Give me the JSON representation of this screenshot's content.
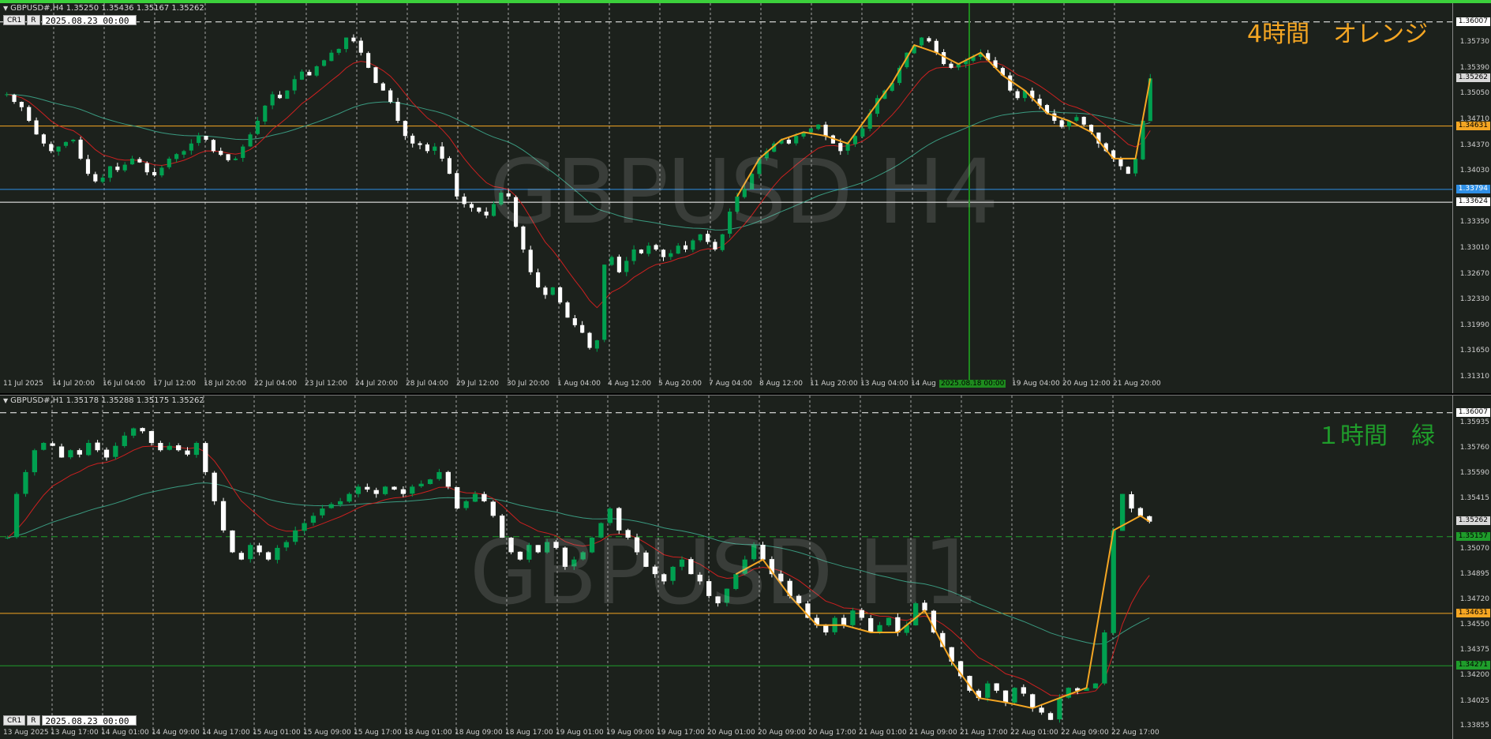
{
  "chart_data": [
    {
      "type": "candlestick",
      "symbol_header": "GBPUSD#,H4  1.35250 1.35436 1.35167 1.35262",
      "watermark": "GBPUSD H4",
      "annotation": "4時間　オレンジ",
      "annotation_color": "#f5a623",
      "datetime_box": "2025.08.23 00:00",
      "ylim": [
        1.3131,
        1.3615
      ],
      "price_ticks": [
        "1.35730",
        "1.35390",
        "1.35050",
        "1.34710",
        "1.34370",
        "1.34030",
        "1.33350",
        "1.33010",
        "1.32670",
        "1.32330",
        "1.31990",
        "1.31650",
        "1.31310"
      ],
      "price_badges": [
        {
          "text": "1.36007",
          "value": 1.36007,
          "bg": "#ffffff",
          "fg": "#000000"
        },
        {
          "text": "1.35262",
          "value": 1.35262,
          "bg": "#d8d8d8",
          "fg": "#000000"
        },
        {
          "text": "1.34631",
          "value": 1.34631,
          "bg": "#f5a623",
          "fg": "#000000"
        },
        {
          "text": "1.33794",
          "value": 1.33794,
          "bg": "#2e8fe6",
          "fg": "#ffffff"
        },
        {
          "text": "1.33624",
          "value": 1.33624,
          "bg": "#ffffff",
          "fg": "#000000"
        }
      ],
      "time_ticks": [
        "11 Jul 2025",
        "14 Jul 20:00",
        "16 Jul 04:00",
        "17 Jul 12:00",
        "18 Jul 20:00",
        "22 Jul 04:00",
        "23 Jul 12:00",
        "24 Jul 20:00",
        "28 Jul 04:00",
        "29 Jul 12:00",
        "30 Jul 20:00",
        "1 Aug 04:00",
        "4 Aug 12:00",
        "5 Aug 20:00",
        "7 Aug 04:00",
        "8 Aug 12:00",
        "11 Aug 20:00",
        "13 Aug 04:00",
        "14 Aug",
        "19 Aug 04:00",
        "20 Aug 12:00",
        "21 Aug 20:00"
      ],
      "cursor_time_label": "2025.08.18 00:00",
      "hlines": [
        {
          "value": 1.36007,
          "color": "#ffffff",
          "style": "dashed"
        },
        {
          "value": 1.34631,
          "color": "#f5a623",
          "style": "solid"
        },
        {
          "value": 1.33794,
          "color": "#2e8fe6",
          "style": "solid"
        },
        {
          "value": 1.33624,
          "color": "#ffffff",
          "style": "solid"
        }
      ],
      "colors": {
        "bull": "#00a050",
        "bear": "#ffffff",
        "ma_fast": "#cc2020",
        "ma_slow": "#3a9a80",
        "zigzag": "#f5a623",
        "cursor": "#1e8a1e"
      },
      "closes": [
        1.3505,
        1.3495,
        1.3488,
        1.347,
        1.3452,
        1.344,
        1.343,
        1.3436,
        1.3442,
        1.3445,
        1.342,
        1.34,
        1.339,
        1.3395,
        1.341,
        1.3405,
        1.3412,
        1.342,
        1.3415,
        1.3402,
        1.3398,
        1.3408,
        1.342,
        1.3426,
        1.343,
        1.344,
        1.345,
        1.3445,
        1.343,
        1.3425,
        1.3418,
        1.342,
        1.3436,
        1.3452,
        1.347,
        1.349,
        1.3505,
        1.35,
        1.351,
        1.3525,
        1.3535,
        1.353,
        1.3542,
        1.355,
        1.356,
        1.3565,
        1.358,
        1.3575,
        1.356,
        1.354,
        1.352,
        1.351,
        1.3495,
        1.347,
        1.345,
        1.344,
        1.3438,
        1.343,
        1.3436,
        1.342,
        1.34,
        1.337,
        1.336,
        1.3355,
        1.335,
        1.3345,
        1.336,
        1.3375,
        1.337,
        1.333,
        1.33,
        1.327,
        1.325,
        1.324,
        1.325,
        1.323,
        1.321,
        1.32,
        1.319,
        1.317,
        1.318,
        1.328,
        1.329,
        1.327,
        1.3285,
        1.33,
        1.3295,
        1.3305,
        1.33,
        1.329,
        1.3295,
        1.3305,
        1.33,
        1.3312,
        1.332,
        1.331,
        1.33,
        1.332,
        1.335,
        1.337,
        1.338,
        1.34,
        1.342,
        1.343,
        1.344,
        1.3445,
        1.344,
        1.345,
        1.3455,
        1.346,
        1.3465,
        1.345,
        1.344,
        1.343,
        1.344,
        1.345,
        1.346,
        1.348,
        1.35,
        1.351,
        1.352,
        1.354,
        1.356,
        1.357,
        1.358,
        1.3575,
        1.356,
        1.3545,
        1.354,
        1.3545,
        1.355,
        1.3555,
        1.356,
        1.355,
        1.354,
        1.353,
        1.351,
        1.35,
        1.351,
        1.35,
        1.349,
        1.348,
        1.347,
        1.3462,
        1.347,
        1.3475,
        1.3465,
        1.3455,
        1.344,
        1.343,
        1.342,
        1.341,
        1.34,
        1.342,
        1.347,
        1.3526
      ]
    },
    {
      "type": "candlestick",
      "symbol_header": "GBPUSD#,H1  1.35178 1.35288 1.35175 1.35262",
      "watermark": "GBPUSD H1",
      "annotation": "１時間　緑",
      "annotation_color": "#1f9d2b",
      "datetime_box": "2025.08.23 00:00",
      "ylim": [
        1.3385,
        1.3606
      ],
      "price_ticks": [
        "1.35935",
        "1.35760",
        "1.35590",
        "1.35415",
        "1.35070",
        "1.34895",
        "1.34720",
        "1.34550",
        "1.34375",
        "1.34200",
        "1.34025",
        "1.33855"
      ],
      "price_badges": [
        {
          "text": "1.36007",
          "value": 1.36007,
          "bg": "#ffffff",
          "fg": "#000000"
        },
        {
          "text": "1.35262",
          "value": 1.35262,
          "bg": "#d8d8d8",
          "fg": "#000000"
        },
        {
          "text": "1.35157",
          "value": 1.35157,
          "bg": "#1f9d2b",
          "fg": "#000000"
        },
        {
          "text": "1.34631",
          "value": 1.34631,
          "bg": "#f5a623",
          "fg": "#000000"
        },
        {
          "text": "1.34271",
          "value": 1.34271,
          "bg": "#1f9d2b",
          "fg": "#000000"
        }
      ],
      "time_ticks": [
        "13 Aug 2025",
        "13 Aug 17:00",
        "14 Aug 01:00",
        "14 Aug 09:00",
        "14 Aug 17:00",
        "15 Aug 01:00",
        "15 Aug 09:00",
        "15 Aug 17:00",
        "18 Aug 01:00",
        "18 Aug 09:00",
        "18 Aug 17:00",
        "19 Aug 01:00",
        "19 Aug 09:00",
        "19 Aug 17:00",
        "20 Aug 01:00",
        "20 Aug 09:00",
        "20 Aug 17:00",
        "21 Aug 01:00",
        "21 Aug 09:00",
        "21 Aug 17:00",
        "22 Aug 01:00",
        "22 Aug 09:00",
        "22 Aug 17:00"
      ],
      "hlines": [
        {
          "value": 1.36007,
          "color": "#ffffff",
          "style": "dashed"
        },
        {
          "value": 1.35157,
          "color": "#1f9d2b",
          "style": "dashed"
        },
        {
          "value": 1.34631,
          "color": "#f5a623",
          "style": "solid"
        },
        {
          "value": 1.34271,
          "color": "#1f9d2b",
          "style": "solid"
        }
      ],
      "colors": {
        "bull": "#00a050",
        "bear": "#ffffff",
        "ma_fast": "#cc2020",
        "ma_slow": "#3a9a80",
        "zigzag": "#f5a623"
      },
      "closes": [
        1.3515,
        1.3545,
        1.356,
        1.3575,
        1.358,
        1.3578,
        1.357,
        1.3575,
        1.3572,
        1.358,
        1.3575,
        1.357,
        1.3578,
        1.3585,
        1.359,
        1.3588,
        1.358,
        1.3575,
        1.3578,
        1.3575,
        1.3572,
        1.358,
        1.356,
        1.354,
        1.352,
        1.3505,
        1.35,
        1.351,
        1.3505,
        1.35,
        1.3508,
        1.3512,
        1.352,
        1.3525,
        1.353,
        1.3535,
        1.3538,
        1.354,
        1.3545,
        1.355,
        1.3548,
        1.3545,
        1.355,
        1.3548,
        1.3545,
        1.355,
        1.3552,
        1.3555,
        1.356,
        1.355,
        1.3535,
        1.354,
        1.3545,
        1.354,
        1.353,
        1.3515,
        1.3505,
        1.35,
        1.351,
        1.3505,
        1.3512,
        1.3508,
        1.3495,
        1.35,
        1.3505,
        1.3515,
        1.3525,
        1.3535,
        1.352,
        1.3515,
        1.3505,
        1.3495,
        1.349,
        1.3485,
        1.3495,
        1.35,
        1.349,
        1.3485,
        1.3475,
        1.347,
        1.348,
        1.349,
        1.35,
        1.351,
        1.35,
        1.349,
        1.3485,
        1.3475,
        1.347,
        1.346,
        1.3455,
        1.345,
        1.346,
        1.3455,
        1.3465,
        1.346,
        1.345,
        1.3455,
        1.346,
        1.345,
        1.3455,
        1.347,
        1.3465,
        1.345,
        1.344,
        1.343,
        1.342,
        1.341,
        1.3405,
        1.3415,
        1.341,
        1.3402,
        1.3412,
        1.3408,
        1.3398,
        1.3395,
        1.339,
        1.3405,
        1.3412,
        1.341,
        1.3412,
        1.3415,
        1.345,
        1.352,
        1.3545,
        1.3535,
        1.353,
        1.3526
      ]
    }
  ]
}
